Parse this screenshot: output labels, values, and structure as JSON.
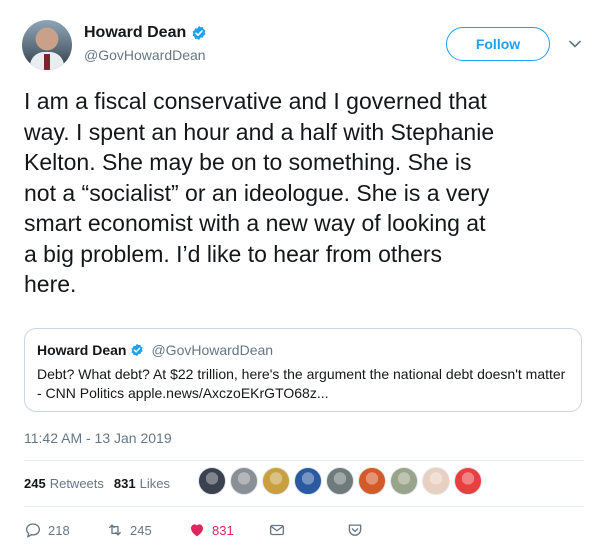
{
  "user": {
    "display_name": "Howard Dean",
    "handle": "@GovHowardDean"
  },
  "follow_label": "Follow",
  "tweet": {
    "text": "I am a fiscal conservative and I governed that\nway. I spent an hour and a half with Stephanie\nKelton. She may be on to something. She is\nnot a “socialist” or an ideologue. She is a very\nsmart economist with a new way of looking at\na big problem. I’d like to hear from others\nhere.",
    "timestamp": "11:42 AM - 13 Jan 2019"
  },
  "quoted": {
    "display_name": "Howard Dean",
    "handle": "@GovHowardDean",
    "text": "Debt? What debt? At $22 trillion, here's the argument the national debt doesn't matter - CNN Politics apple.news/AxczoEKrGTO68z..."
  },
  "stats": {
    "retweets_count": "245",
    "retweets_label": "Retweets",
    "likes_count": "831",
    "likes_label": "Likes"
  },
  "liker_avatars": [
    "#3a4250",
    "#8a8f96",
    "#c8a040",
    "#2b5aa0",
    "#6e7b7a",
    "#d45a2a",
    "#9aa48a",
    "#e8d0c0",
    "#e84040"
  ],
  "actions": {
    "reply_count": "218",
    "retweet_count": "245",
    "like_count": "831"
  },
  "colors": {
    "accent": "#1da1f2",
    "like": "#e0245e",
    "muted": "#657786"
  }
}
